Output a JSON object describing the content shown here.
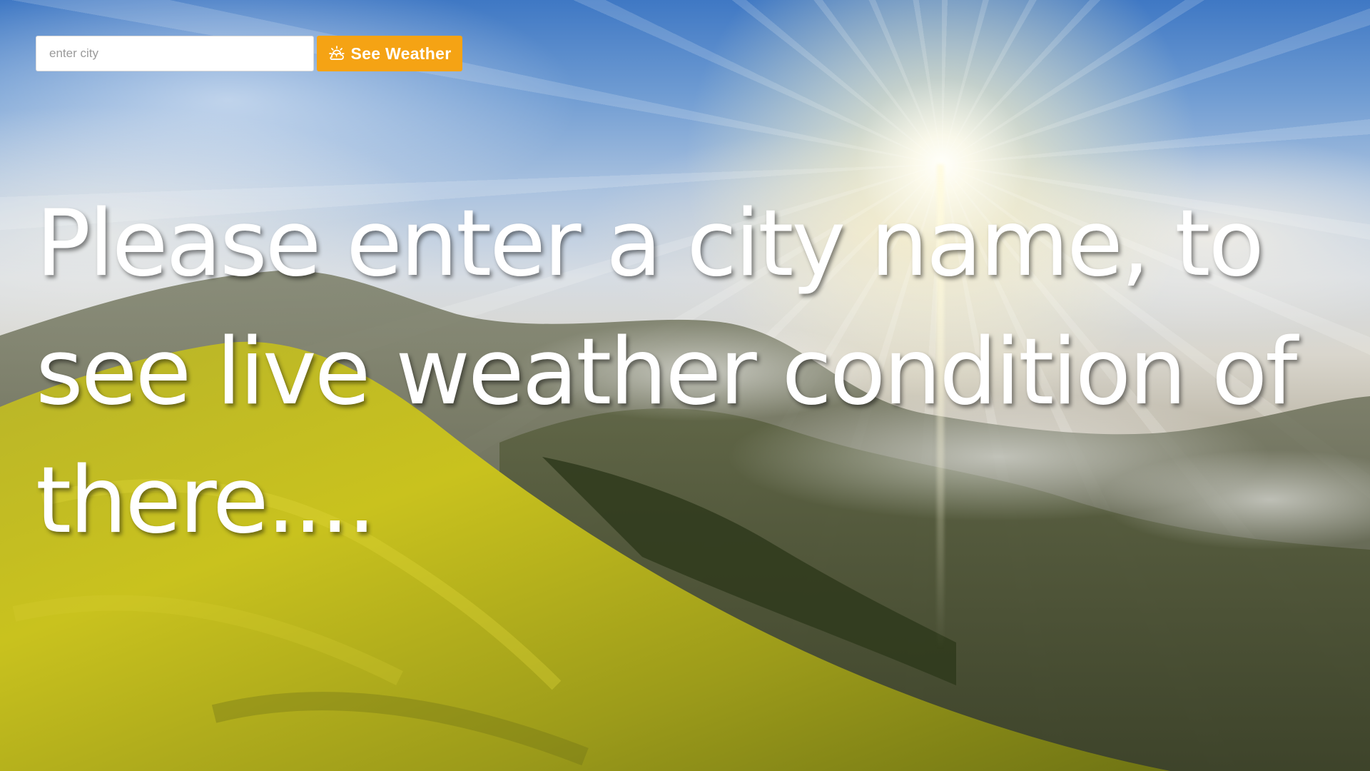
{
  "search": {
    "placeholder": "enter city",
    "value": "",
    "button_label": "See Weather",
    "button_icon": "sun-cloud-icon",
    "button_color": "#f5a314"
  },
  "main": {
    "message": "Please enter a city name, to see live weather condition of there...."
  },
  "background": {
    "description_icon": "landscape-sunrise-image"
  }
}
